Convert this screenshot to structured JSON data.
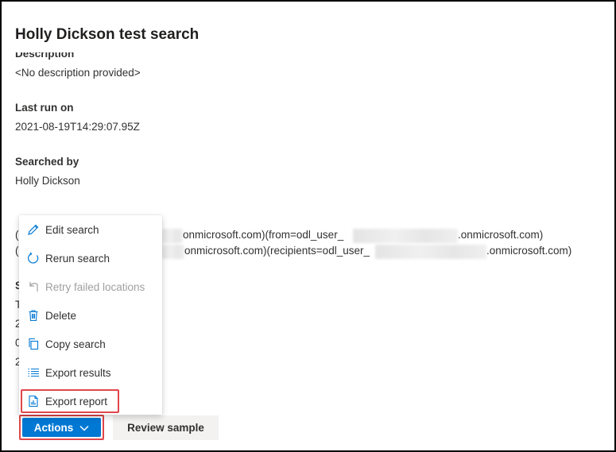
{
  "panel": {
    "title": "Holly Dickson test search"
  },
  "details": {
    "description_label": "Description",
    "description_value": "<No description provided>",
    "last_run_label": "Last run on",
    "last_run_value": "2021-08-19T14:29:07.95Z",
    "searched_by_label": "Searched by",
    "searched_by_value": "Holly Dickson",
    "conditions_line1_prefix": "(",
    "conditions_line1_mid": "onmicrosoft.com)(from=odl_user_",
    "conditions_line1_end": ".onmicrosoft.com)",
    "conditions_line2_prefix": "(",
    "conditions_line2_mid": "onmicrosoft.com)(recipients=odl_user_",
    "conditions_line2_end": ".onmicrosoft.com)",
    "status_section_fragments": [
      "S",
      "T",
      "2",
      "0",
      "2"
    ]
  },
  "menu": {
    "items": [
      {
        "label": "Edit search",
        "icon": "pencil-icon",
        "enabled": true
      },
      {
        "label": "Rerun search",
        "icon": "refresh-icon",
        "enabled": true
      },
      {
        "label": "Retry failed locations",
        "icon": "retry-icon",
        "enabled": false
      },
      {
        "label": "Delete",
        "icon": "trash-icon",
        "enabled": true
      },
      {
        "label": "Copy search",
        "icon": "copy-icon",
        "enabled": true
      },
      {
        "label": "Export results",
        "icon": "list-icon",
        "enabled": true
      },
      {
        "label": "Export report",
        "icon": "report-icon",
        "enabled": true
      }
    ]
  },
  "footer": {
    "actions_label": "Actions",
    "review_label": "Review sample"
  },
  "colors": {
    "accent": "#0078d4",
    "highlight": "#e0464b"
  }
}
